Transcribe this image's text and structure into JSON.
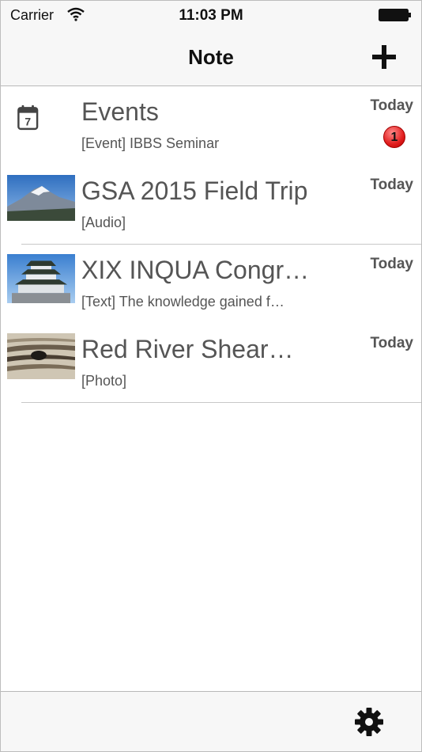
{
  "status": {
    "carrier": "Carrier",
    "time": "11:03 PM"
  },
  "nav": {
    "title": "Note"
  },
  "notes": [
    {
      "icon": "calendar-icon",
      "day": "7",
      "title": "Events",
      "subtitle": "[Event] IBBS Seminar",
      "date": "Today",
      "badge": "1"
    },
    {
      "icon": "mountain-photo-thumbnail",
      "title": "GSA 2015 Field Trip",
      "subtitle": "[Audio]",
      "date": "Today"
    },
    {
      "icon": "castle-photo-thumbnail",
      "title": "XIX INQUA Congr…",
      "subtitle": "[Text] The knowledge gained f…",
      "date": "Today"
    },
    {
      "icon": "rock-shear-photo-thumbnail",
      "title": "Red River Shear…",
      "subtitle": "[Photo]",
      "date": "Today"
    }
  ],
  "toolbar": {
    "settings_icon": "gear-icon"
  },
  "colors": {
    "bar_bg": "#f7f7f7",
    "text": "#555555",
    "badge": "#e11d1d"
  }
}
